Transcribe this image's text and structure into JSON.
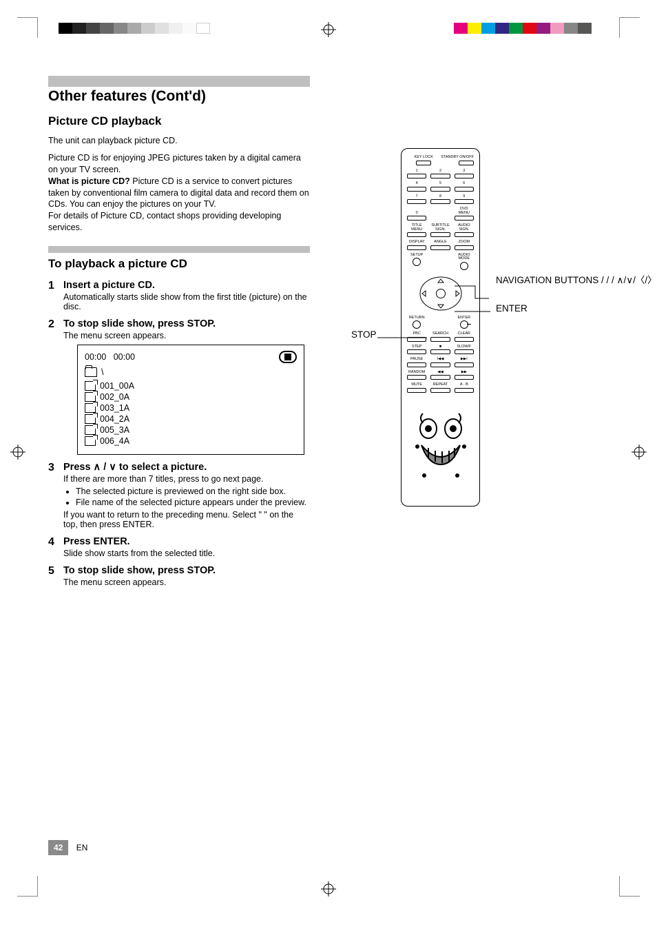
{
  "section": {
    "title": "Other features (Cont'd)",
    "sub1_title": "Picture CD playback",
    "sub1_p1": "The unit can playback picture CD.",
    "sub1_p2_a": "Picture CD is for enjoying JPEG pictures taken by a digital camera on your TV screen.",
    "sub1_p2_b": "What is picture CD?",
    "sub1_p2_c": " Picture CD is a service to convert pictures taken by conventional film camera to digital data and record them on CDs. You can enjoy the pictures on your TV.",
    "sub1_p2_d": "For details of Picture CD, contact shops providing developing services.",
    "sub2_title": "To playback a picture CD"
  },
  "steps": {
    "s1": "Insert a picture CD.",
    "s1_note": "Automatically starts slide show from the first title (picture) on the disc.",
    "s2": "To stop slide show, press STOP.",
    "s2_note": "The menu screen appears."
  },
  "screen": {
    "time1": "00:00",
    "time2": "00:00",
    "folder_label": "\\",
    "files": [
      "001_00A",
      "002_0A",
      "003_1A",
      "004_2A",
      "005_3A",
      "006_4A"
    ]
  },
  "step3": {
    "text_a": "Press ",
    "text_b": " to select a picture.",
    "s3_note": "If there are more than 7 titles, press     to go next page.",
    "bullets": [
      "The selected picture is previewed on the right side box.",
      "File name of the selected picture appears under the preview."
    ],
    "tail": "If you want to return to the preceding menu. Select \"      \" on the top, then press ENTER."
  },
  "step4": {
    "text": "Press ENTER.",
    "note": "Slide show starts from the selected title."
  },
  "step5": {
    "text": "To stop slide show, press STOP.",
    "note": "The menu screen appears."
  },
  "callouts": {
    "stop": "STOP",
    "nav": "NAVIGATION BUTTONS    /   /   /",
    "enter": "ENTER"
  },
  "remote": {
    "row0": {
      "left": "KEY\nLOCK",
      "right": "STANDBY\nON/OFF"
    },
    "nums": [
      "1",
      "2",
      "3",
      "4",
      "5",
      "6",
      "7",
      "8",
      "9",
      "0"
    ],
    "dvdmenu": "DVD\nMENU",
    "rowA": [
      "TITLE\nMENU",
      "SUBTITLE\nSIGN.",
      "AUDIO\nSIGN."
    ],
    "rowB": [
      "DISPLAY",
      "ANGLE",
      "ZOOM"
    ],
    "setup": "SETUP",
    "audiomode": "AUDIO\nMODE",
    "return": "RETURN",
    "enter": "ENTER",
    "rowD": [
      "PBC",
      "SEARCH",
      "CLEAR"
    ],
    "rowE": [
      "STEP",
      "■",
      "SLOW/F"
    ],
    "rowF": [
      "PAUSE",
      "I◀◀",
      "▶▶I"
    ],
    "rowG": [
      "RANDOM",
      "◀◀",
      "▶▶"
    ],
    "rowH": [
      "MUTE",
      "REPEAT",
      "A - B"
    ]
  },
  "footer": {
    "page": "42",
    "label": "EN"
  }
}
